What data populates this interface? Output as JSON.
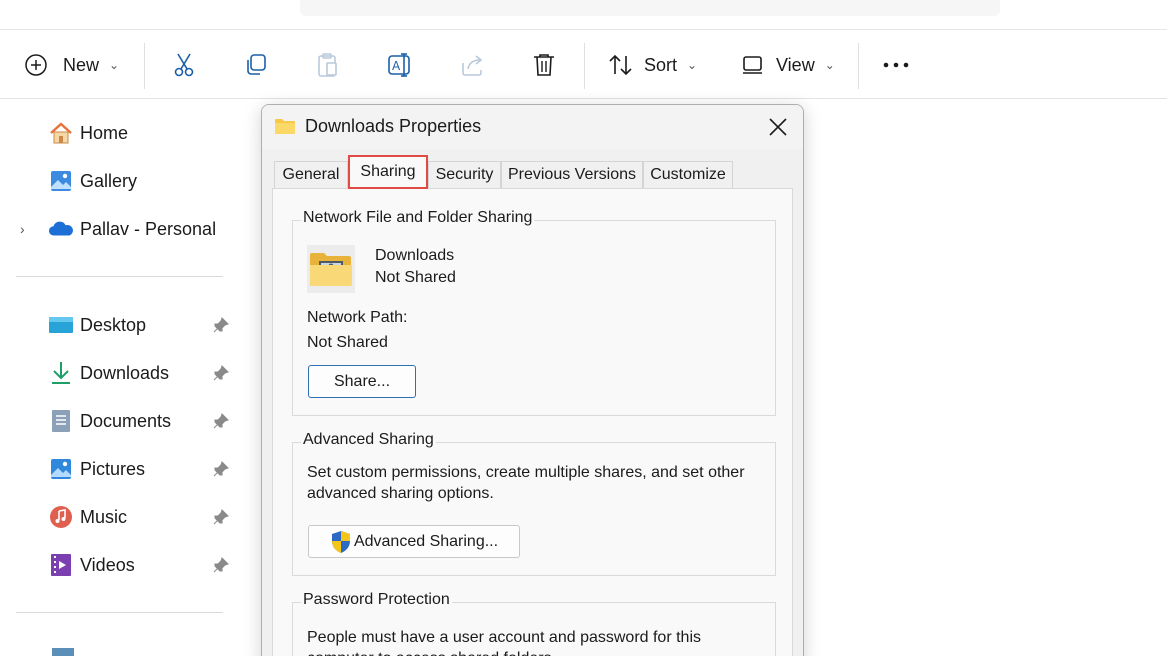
{
  "toolbar": {
    "new_label": "New",
    "sort_label": "Sort",
    "view_label": "View",
    "icons": [
      "cut-icon",
      "copy-icon",
      "paste-icon",
      "rename-icon",
      "share-icon",
      "delete-icon",
      "more-icon"
    ]
  },
  "sidebar": {
    "top_items": [
      {
        "label": "Home",
        "icon": "home-icon"
      },
      {
        "label": "Gallery",
        "icon": "gallery-icon"
      },
      {
        "label": "Pallav - Personal",
        "icon": "onedrive-icon"
      }
    ],
    "pinned_items": [
      {
        "label": "Desktop",
        "icon": "desktop-icon"
      },
      {
        "label": "Downloads",
        "icon": "downloads-icon"
      },
      {
        "label": "Documents",
        "icon": "documents-icon"
      },
      {
        "label": "Pictures",
        "icon": "pictures-icon"
      },
      {
        "label": "Music",
        "icon": "music-icon"
      },
      {
        "label": "Videos",
        "icon": "videos-icon"
      }
    ]
  },
  "dialog": {
    "title": "Downloads Properties",
    "tabs": [
      "General",
      "Sharing",
      "Security",
      "Previous Versions",
      "Customize"
    ],
    "active_tab": "Sharing",
    "network_sharing": {
      "group_title": "Network File and Folder Sharing",
      "folder_name": "Downloads",
      "folder_status": "Not Shared",
      "path_label": "Network Path:",
      "path_value": "Not Shared",
      "share_button": "Share..."
    },
    "advanced_sharing": {
      "group_title": "Advanced Sharing",
      "description": "Set custom permissions, create multiple shares, and set other advanced sharing options.",
      "button": "Advanced Sharing..."
    },
    "password_protection": {
      "group_title": "Password Protection",
      "description": "People must have a user account and password for this computer to access shared folders."
    }
  },
  "colors": {
    "highlight": "#e04b45",
    "accent": "#0067c0"
  }
}
